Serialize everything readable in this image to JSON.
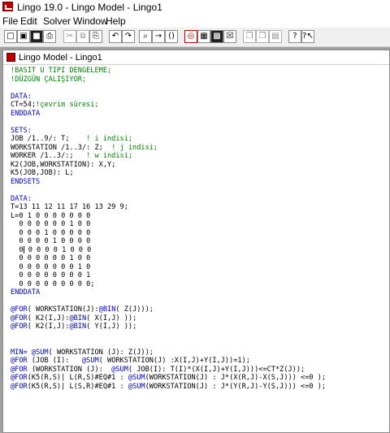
{
  "window": {
    "title": "Lingo 19.0 - Lingo Model - Lingo1"
  },
  "menu": [
    {
      "label": "File"
    },
    {
      "label": "Edit"
    },
    {
      "label": "Solver"
    },
    {
      "label": "Window"
    },
    {
      "label": "Help"
    }
  ],
  "toolbar": [
    {
      "name": "new-icon",
      "glyph": "□",
      "style": ""
    },
    {
      "name": "open-icon",
      "glyph": "▣",
      "style": ""
    },
    {
      "name": "save-icon",
      "glyph": "■",
      "style": "dark"
    },
    {
      "name": "print-icon",
      "glyph": "⎙",
      "style": ""
    },
    {
      "name": "cut-icon",
      "glyph": "✂",
      "style": "gray"
    },
    {
      "name": "copy-icon",
      "glyph": "⧉",
      "style": "gray"
    },
    {
      "name": "paste-icon",
      "glyph": "⎘",
      "style": ""
    },
    {
      "name": "undo-icon",
      "glyph": "↶",
      "style": ""
    },
    {
      "name": "redo-icon",
      "glyph": "↷",
      "style": ""
    },
    {
      "name": "find-icon",
      "glyph": "⌕",
      "style": ""
    },
    {
      "name": "goto-line-icon",
      "glyph": "→",
      "style": ""
    },
    {
      "name": "match-parenthesis-icon",
      "glyph": "()",
      "style": ""
    },
    {
      "name": "solve-icon",
      "glyph": "◎",
      "style": "red"
    },
    {
      "name": "solution-icon",
      "glyph": "▦",
      "style": ""
    },
    {
      "name": "matrix-picture-icon",
      "glyph": "▩",
      "style": "dark"
    },
    {
      "name": "options-icon",
      "glyph": "☒",
      "style": ""
    },
    {
      "name": "send-to-back-icon",
      "glyph": "❐",
      "style": "gray"
    },
    {
      "name": "close-all-icon",
      "glyph": "❐",
      "style": "gray"
    },
    {
      "name": "tile-icon",
      "glyph": "▤",
      "style": "gray"
    },
    {
      "name": "help-icon",
      "glyph": "?",
      "style": ""
    },
    {
      "name": "context-help-icon",
      "glyph": "?↖",
      "style": ""
    }
  ],
  "document": {
    "title": "Lingo Model - Lingo1"
  },
  "code": [
    [
      {
        "t": "!BASİT U TİPİ DENGELEME;",
        "c": "cm"
      }
    ],
    [
      {
        "t": "!DÜZGÜN ÇALIŞIYOR;",
        "c": "cm"
      }
    ],
    [
      {
        "t": ""
      }
    ],
    [
      {
        "t": "DATA:",
        "c": "kw"
      }
    ],
    [
      {
        "t": "CT=54;"
      },
      {
        "t": "!çevrim süresi;",
        "c": "cm"
      }
    ],
    [
      {
        "t": "ENDDATA",
        "c": "kw"
      }
    ],
    [
      {
        "t": ""
      }
    ],
    [
      {
        "t": "SETS:",
        "c": "kw"
      }
    ],
    [
      {
        "t": "JOB /1..9/: T;    "
      },
      {
        "t": "! i indisi;",
        "c": "cm"
      }
    ],
    [
      {
        "t": "WORKSTATION /1..3/: Z;  "
      },
      {
        "t": "! j indisi;",
        "c": "cm"
      }
    ],
    [
      {
        "t": "WORKER /1..3/:;   "
      },
      {
        "t": "! w indisi;",
        "c": "cm"
      }
    ],
    [
      {
        "t": "K2(JOB,WORKSTATION): X,Y;"
      }
    ],
    [
      {
        "t": "K5(JOB,JOB): L;"
      }
    ],
    [
      {
        "t": "ENDSETS",
        "c": "kw"
      }
    ],
    [
      {
        "t": ""
      }
    ],
    [
      {
        "t": "DATA:",
        "c": "kw"
      }
    ],
    [
      {
        "t": "T=13 11 12 11 17 16 13 29 9;"
      }
    ],
    [
      {
        "t": "L=0 1 0 0 0 0 0 0 0"
      }
    ],
    [
      {
        "t": "  0 0 0 0 0 0 1 0 0"
      }
    ],
    [
      {
        "t": "  0 0 0 1 0 0 0 0 0"
      }
    ],
    [
      {
        "t": "  0 0 0 0 1 0 0 0 0"
      }
    ],
    [
      {
        "t": "  0",
        "caret": true
      },
      {
        "t": " 0 0 0 0 1 0 0 0"
      }
    ],
    [
      {
        "t": "  0 0 0 0 0 0 1 0 0"
      }
    ],
    [
      {
        "t": "  0 0 0 0 0 0 0 1 0"
      }
    ],
    [
      {
        "t": "  0 0 0 0 0 0 0 0 1"
      }
    ],
    [
      {
        "t": "  0 0 0 0 0 0 0 0 0;"
      }
    ],
    [
      {
        "t": "ENDDATA",
        "c": "kw"
      }
    ],
    [
      {
        "t": ""
      }
    ],
    [
      {
        "t": "@FOR",
        "c": "kw"
      },
      {
        "t": "( WORKSTATION(J):"
      },
      {
        "t": "@BIN",
        "c": "kw"
      },
      {
        "t": "( Z(J)));"
      }
    ],
    [
      {
        "t": "@FOR",
        "c": "kw"
      },
      {
        "t": "( K2(I,J):"
      },
      {
        "t": "@BIN",
        "c": "kw"
      },
      {
        "t": "( X(I,J) ));"
      }
    ],
    [
      {
        "t": "@FOR",
        "c": "kw"
      },
      {
        "t": "( K2(I,J):"
      },
      {
        "t": "@BIN",
        "c": "kw"
      },
      {
        "t": "( Y(I,J) ));"
      }
    ],
    [
      {
        "t": ""
      }
    ],
    [
      {
        "t": ""
      }
    ],
    [
      {
        "t": "MIN=",
        "c": "kw"
      },
      {
        "t": " "
      },
      {
        "t": "@SUM",
        "c": "kw"
      },
      {
        "t": "( WORKSTATION (J): Z(J));"
      }
    ],
    [
      {
        "t": "@FOR",
        "c": "kw"
      },
      {
        "t": " (JOB (I):   "
      },
      {
        "t": "@SUM",
        "c": "kw"
      },
      {
        "t": "( WORKSTATION(J) :X(I,J)+Y(I,J))=1);"
      }
    ],
    [
      {
        "t": "@FOR",
        "c": "kw"
      },
      {
        "t": " (WORKSTATION (J):  "
      },
      {
        "t": "@SUM",
        "c": "kw"
      },
      {
        "t": "( JOB(I): T(I)*(X(I,J)+Y(I,J)))<=CT*Z(J));"
      }
    ],
    [
      {
        "t": "@FOR",
        "c": "kw"
      },
      {
        "t": "(K5(R,S)| L(R,S)#EQ#1 : "
      },
      {
        "t": "@SUM",
        "c": "kw"
      },
      {
        "t": "(WORKSTATION(J) : J*(X(R,J)-X(S,J))) <=0 );"
      }
    ],
    [
      {
        "t": "@FOR",
        "c": "kw"
      },
      {
        "t": "(K5(R,S)| L(S,R)#EQ#1 : "
      },
      {
        "t": "@SUM",
        "c": "kw"
      },
      {
        "t": "(WORKSTATION(J) : J*(Y(R,J)-Y(S,J))) <=0 );"
      }
    ]
  ]
}
